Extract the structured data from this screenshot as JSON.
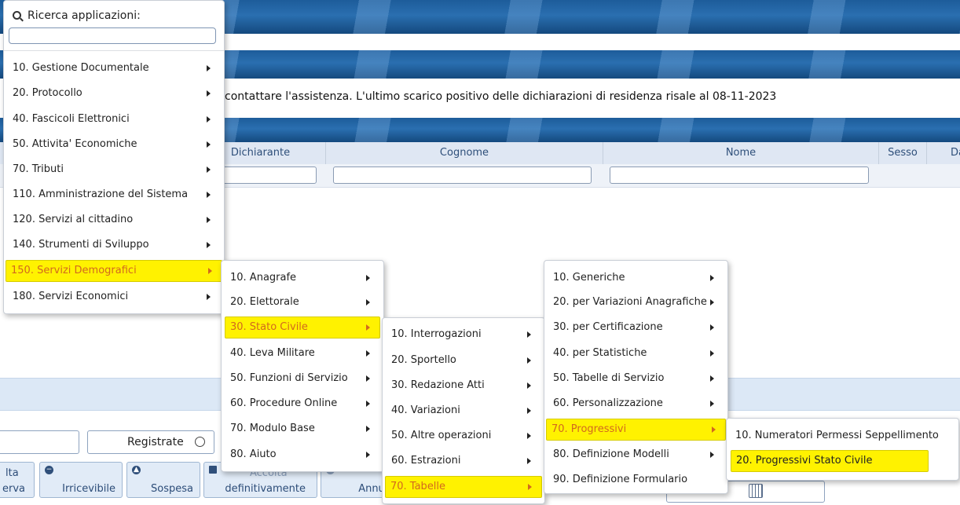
{
  "app_menu": {
    "search_label": "Ricerca applicazioni:",
    "search_value": "",
    "items": [
      {
        "label": "10. Gestione Documentale"
      },
      {
        "label": "20. Protocollo"
      },
      {
        "label": "40. Fascicoli Elettronici"
      },
      {
        "label": "50. Attivita' Economiche"
      },
      {
        "label": "70. Tributi"
      },
      {
        "label": "110. Amministrazione del Sistema"
      },
      {
        "label": "120. Servizi al cittadino"
      },
      {
        "label": "140. Strumenti di Sviluppo"
      },
      {
        "label": "150. Servizi Demografici"
      },
      {
        "label": "180. Servizi Economici"
      }
    ],
    "selected_index": 8
  },
  "servizi_demografici_menu": {
    "items": [
      {
        "label": "10. Anagrafe"
      },
      {
        "label": "20. Elettorale"
      },
      {
        "label": "30. Stato Civile"
      },
      {
        "label": "40. Leva Militare"
      },
      {
        "label": "50. Funzioni di Servizio"
      },
      {
        "label": "60. Procedure Online"
      },
      {
        "label": "70. Modulo Base"
      },
      {
        "label": "80. Aiuto"
      }
    ],
    "selected_index": 2
  },
  "stato_civile_menu": {
    "items": [
      {
        "label": "10. Interrogazioni"
      },
      {
        "label": "20. Sportello"
      },
      {
        "label": "30. Redazione Atti"
      },
      {
        "label": "40. Variazioni"
      },
      {
        "label": "50. Altre operazioni"
      },
      {
        "label": "60. Estrazioni"
      },
      {
        "label": "70. Tabelle"
      }
    ],
    "selected_index": 6
  },
  "tabelle_menu": {
    "items": [
      {
        "label": "10. Generiche"
      },
      {
        "label": "20. per Variazioni Anagrafiche"
      },
      {
        "label": "30. per Certificazione"
      },
      {
        "label": "40. per Statistiche"
      },
      {
        "label": "50. Tabelle di Servizio"
      },
      {
        "label": "60. Personalizzazione"
      },
      {
        "label": "70. Progressivi"
      },
      {
        "label": "80. Definizione Modelli"
      },
      {
        "label": "90. Definizione Formulario"
      }
    ],
    "selected_index": 6
  },
  "progressivi_menu": {
    "items": [
      {
        "label": "10. Numeratori Permessi Seppellimento"
      },
      {
        "label": "20. Progressivi Stato Civile"
      }
    ],
    "selected_index": 1
  },
  "page": {
    "message": "contattare l'assistenza. L'ultimo scarico positivo delle dichiarazioni di residenza risale al 08-11-2023",
    "columns": [
      "Dichiarante",
      "Cognome",
      "Nome",
      "Sesso",
      "Da"
    ],
    "radio_registrate": "Registrate",
    "buttons": {
      "lta_top": "lta",
      "lta_bottom": "erva",
      "irricevibile": "Irricevibile",
      "sospesa": "Sospesa",
      "accolta_top": "Accolta",
      "accolta_bottom": "definitivamente",
      "annulla": "Annulla"
    }
  },
  "colors": {
    "highlight": "#fff200",
    "highlight_text": "#d2691e",
    "header_band": "#1d5c9a"
  }
}
